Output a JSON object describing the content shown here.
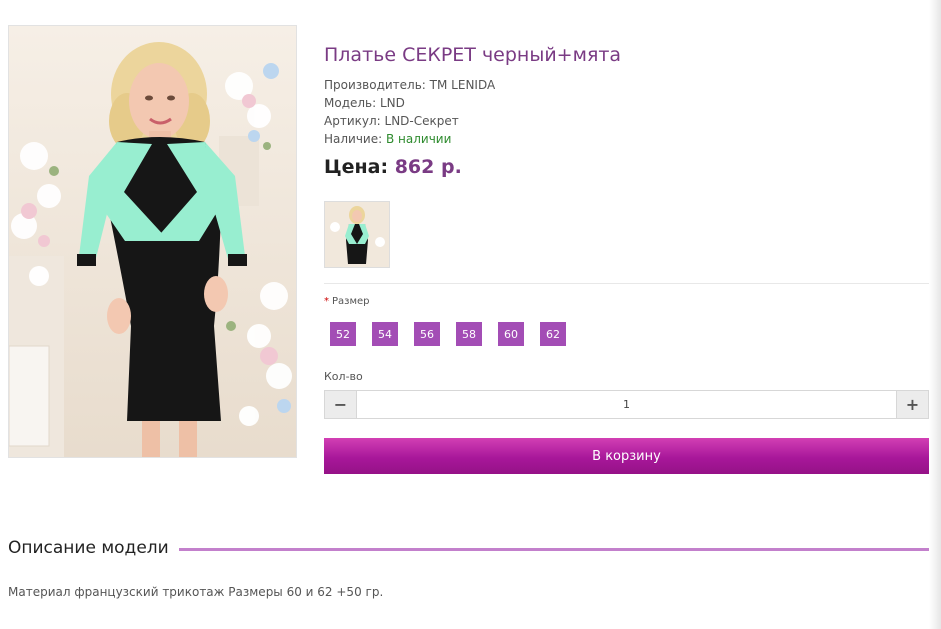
{
  "product": {
    "title": "Платье СЕКРЕТ черный+мята",
    "manufacturer_label": "Производитель:",
    "manufacturer": "ТМ LENIDA",
    "model_label": "Модель:",
    "model": "LND",
    "sku_label": "Артикул:",
    "sku": "LND-Секрет",
    "availability_label": "Наличие:",
    "availability": "В наличии",
    "price_label": "Цена:",
    "price": "862 р."
  },
  "options": {
    "required_mark": "*",
    "size_label": "Размер",
    "sizes": [
      "52",
      "54",
      "56",
      "58",
      "60",
      "62"
    ]
  },
  "quantity": {
    "label": "Кол-во",
    "value": "1",
    "minus": "−",
    "plus": "+"
  },
  "cart": {
    "button_label": "В корзину"
  },
  "description": {
    "title": "Описание модели",
    "text": "Материал французский трикотаж Размеры 60 и 62 +50 гр."
  },
  "colors": {
    "accent": "#7a3b84",
    "size_button": "#a34db5",
    "cart_button": "#b11ea3",
    "in_stock": "#2e8b2e",
    "divider": "#c380cc"
  }
}
